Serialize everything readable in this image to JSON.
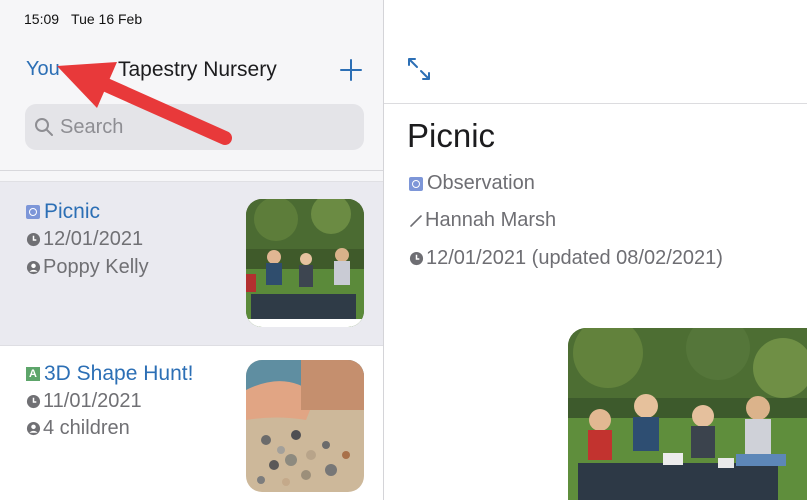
{
  "status_bar": {
    "time": "15:09",
    "date": "Tue 16 Feb"
  },
  "nav": {
    "you_label": "You",
    "title": "Tapestry Nursery",
    "add_icon": "plus-icon"
  },
  "search": {
    "placeholder": "Search",
    "value": ""
  },
  "list": [
    {
      "title": "Picnic",
      "type_badge": "observation-icon",
      "date": "12/01/2021",
      "person": "Poppy Kelly",
      "selected": true
    },
    {
      "title": "3D Shape Hunt!",
      "type_badge": "activity-icon",
      "date": "11/01/2021",
      "person": "4 children",
      "selected": false
    }
  ],
  "detail": {
    "title": "Picnic",
    "type": "Observation",
    "author": "Hannah Marsh",
    "date": "12/01/2021 (updated 08/02/2021)"
  },
  "colors": {
    "accent": "#2c6fb5",
    "annotation_arrow": "#e8393a",
    "sidebar_bg": "#f6f6f8",
    "selected_row": "#eaeaf0"
  }
}
